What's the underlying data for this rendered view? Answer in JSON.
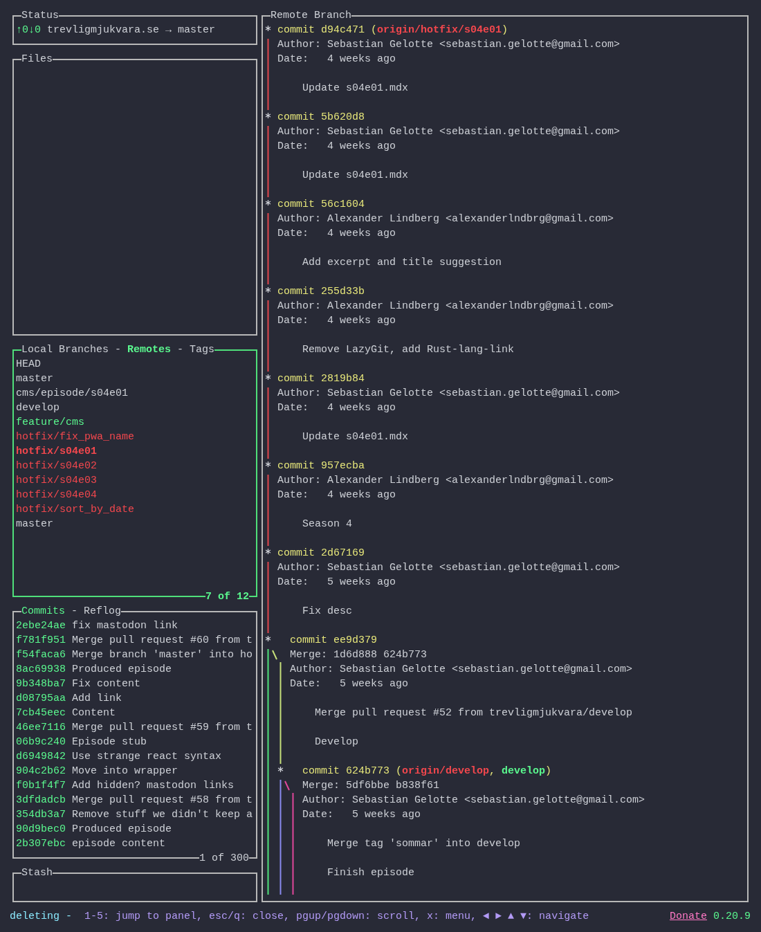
{
  "status_panel": {
    "title": "Status",
    "active": false,
    "sync": "↑0↓0",
    "repo": "trevligmjukvara.se → master"
  },
  "files_panel": {
    "title": "Files",
    "active": false
  },
  "branches_panel": {
    "active": true,
    "separator": "-",
    "count": "7 of 12",
    "tabs": [
      {
        "label": "Local Branches",
        "selected": false
      },
      {
        "label": "Remotes",
        "selected": true
      },
      {
        "label": "Tags",
        "selected": false
      }
    ],
    "items": [
      {
        "name": "HEAD",
        "color": "#cdd0d6",
        "selected": false
      },
      {
        "name": "master",
        "color": "#cdd0d6",
        "selected": false
      },
      {
        "name": "cms/episode/s04e01",
        "color": "#cdd0d6",
        "selected": false
      },
      {
        "name": "develop",
        "color": "#cdd0d6",
        "selected": false
      },
      {
        "name": "feature/cms",
        "color": "#5af78e",
        "selected": false
      },
      {
        "name": "hotfix/fix_pwa_name",
        "color": "#f2474d",
        "selected": false
      },
      {
        "name": "hotfix/s04e01",
        "color": "#f2474d",
        "selected": true
      },
      {
        "name": "hotfix/s04e02",
        "color": "#f2474d",
        "selected": false
      },
      {
        "name": "hotfix/s04e03",
        "color": "#f2474d",
        "selected": false
      },
      {
        "name": "hotfix/s04e04",
        "color": "#f2474d",
        "selected": false
      },
      {
        "name": "hotfix/sort_by_date",
        "color": "#f2474d",
        "selected": false
      },
      {
        "name": "master",
        "color": "#cdd0d6",
        "selected": false
      }
    ]
  },
  "commits_panel": {
    "active": false,
    "separator": "-",
    "count": "1 of 300",
    "tabs": [
      {
        "label": "Commits",
        "selected": true
      },
      {
        "label": "Reflog",
        "selected": false
      }
    ],
    "commits": [
      {
        "hash": "2ebe24ae",
        "subject": "fix mastodon link"
      },
      {
        "hash": "f781f951",
        "subject": "Merge pull request #60 from t"
      },
      {
        "hash": "f54faca6",
        "subject": "Merge branch 'master' into ho"
      },
      {
        "hash": "8ac69938",
        "subject": "Produced episode"
      },
      {
        "hash": "9b348ba7",
        "subject": "Fix content"
      },
      {
        "hash": "d08795aa",
        "subject": "Add link"
      },
      {
        "hash": "7cb45eec",
        "subject": "Content"
      },
      {
        "hash": "46ee7116",
        "subject": "Merge pull request #59 from t"
      },
      {
        "hash": "06b9c240",
        "subject": "Episode stub"
      },
      {
        "hash": "d6949842",
        "subject": "Use strange react syntax"
      },
      {
        "hash": "904c2b62",
        "subject": "Move into wrapper"
      },
      {
        "hash": "f0b1f4f7",
        "subject": "Add hidden? mastodon links"
      },
      {
        "hash": "3dfdadcb",
        "subject": "Merge pull request #58 from t"
      },
      {
        "hash": "354db3a7",
        "subject": "Remove stuff we didn't keep a"
      },
      {
        "hash": "90d9bec0",
        "subject": "Produced episode"
      },
      {
        "hash": "2b307ebc",
        "subject": "episode content"
      }
    ]
  },
  "stash_panel": {
    "title": "Stash",
    "active": false
  },
  "remote_branch": {
    "title": "Remote Branch",
    "active": false,
    "commits": [
      {
        "header": [
          {
            "text": "commit d94c471 (",
            "kind": "plain"
          },
          {
            "text": "origin/hotfix/s04e01",
            "kind": "remote"
          },
          {
            "text": ")",
            "kind": "plain"
          }
        ],
        "author": "Author: Sebastian Gelotte <sebastian.gelotte@gmail.com>",
        "date": "Date:   4 weeks ago",
        "message": [
          "Update s04e01.mdx"
        ],
        "lanes": [
          {
            "color": "#e0474c"
          }
        ]
      },
      {
        "header": [
          {
            "text": "commit 5b620d8",
            "kind": "plain"
          }
        ],
        "author": "Author: Sebastian Gelotte <sebastian.gelotte@gmail.com>",
        "date": "Date:   4 weeks ago",
        "message": [
          "Update s04e01.mdx"
        ],
        "lanes": [
          {
            "color": "#e0474c"
          }
        ]
      },
      {
        "header": [
          {
            "text": "commit 56c1604",
            "kind": "plain"
          }
        ],
        "author": "Author: Alexander Lindberg <alexanderlndbrg@gmail.com>",
        "date": "Date:   4 weeks ago",
        "message": [
          "Add excerpt and title suggestion"
        ],
        "lanes": [
          {
            "color": "#e0474c"
          }
        ]
      },
      {
        "header": [
          {
            "text": "commit 255d33b",
            "kind": "plain"
          }
        ],
        "author": "Author: Alexander Lindberg <alexanderlndbrg@gmail.com>",
        "date": "Date:   4 weeks ago",
        "message": [
          "Remove LazyGit, add Rust-lang-link"
        ],
        "lanes": [
          {
            "color": "#e0474c"
          }
        ]
      },
      {
        "header": [
          {
            "text": "commit 2819b84",
            "kind": "plain"
          }
        ],
        "author": "Author: Sebastian Gelotte <sebastian.gelotte@gmail.com>",
        "date": "Date:   4 weeks ago",
        "message": [
          "Update s04e01.mdx"
        ],
        "lanes": [
          {
            "color": "#e0474c"
          }
        ]
      },
      {
        "header": [
          {
            "text": "commit 957ecba",
            "kind": "plain"
          }
        ],
        "author": "Author: Alexander Lindberg <alexanderlndbrg@gmail.com>",
        "date": "Date:   4 weeks ago",
        "message": [
          "Season 4"
        ],
        "lanes": [
          {
            "color": "#e0474c"
          }
        ]
      },
      {
        "header": [
          {
            "text": "commit 2d67169",
            "kind": "plain"
          }
        ],
        "author": "Author: Sebastian Gelotte <sebastian.gelotte@gmail.com>",
        "date": "Date:   5 weeks ago",
        "message": [
          "Fix desc"
        ],
        "lanes": [
          {
            "color": "#e0474c"
          }
        ]
      },
      {
        "header": [
          {
            "text": "commit ee9d379",
            "kind": "plain"
          }
        ],
        "merge": "Merge: 1d6d888 624b773",
        "author": "Author: Sebastian Gelotte <sebastian.gelotte@gmail.com>",
        "date": "Date:   5 weeks ago",
        "message": [
          "Merge pull request #52 from trevligmjukvara/develop",
          "Develop"
        ],
        "lanes": [
          {
            "color": "#4fe07a"
          },
          {
            "color": "#c6e07a"
          }
        ]
      },
      {
        "header": [
          {
            "text": "commit 624b773 (",
            "kind": "plain"
          },
          {
            "text": "origin/develop",
            "kind": "remote"
          },
          {
            "text": ", ",
            "kind": "plain"
          },
          {
            "text": "develop",
            "kind": "local"
          },
          {
            "text": ")",
            "kind": "plain"
          }
        ],
        "merge": "Merge: 5df6bbe b838f61",
        "author": "Author: Sebastian Gelotte <sebastian.gelotte@gmail.com>",
        "date": "Date:   5 weeks ago",
        "message": [
          "Merge tag 'sommar' into develop",
          "Finish episode"
        ],
        "lanes": [
          {
            "color": "#4fe07a"
          },
          {
            "color": "#8a8af0"
          },
          {
            "color": "#e0479a"
          }
        ]
      }
    ]
  },
  "status_bar": {
    "mode": "deleting -",
    "hints": "1-5: jump to panel, esc/q: close, pgup/pgdown: scroll, x: menu, ◄ ► ▲ ▼: navigate",
    "donate": "Donate",
    "version": "0.20.9"
  }
}
